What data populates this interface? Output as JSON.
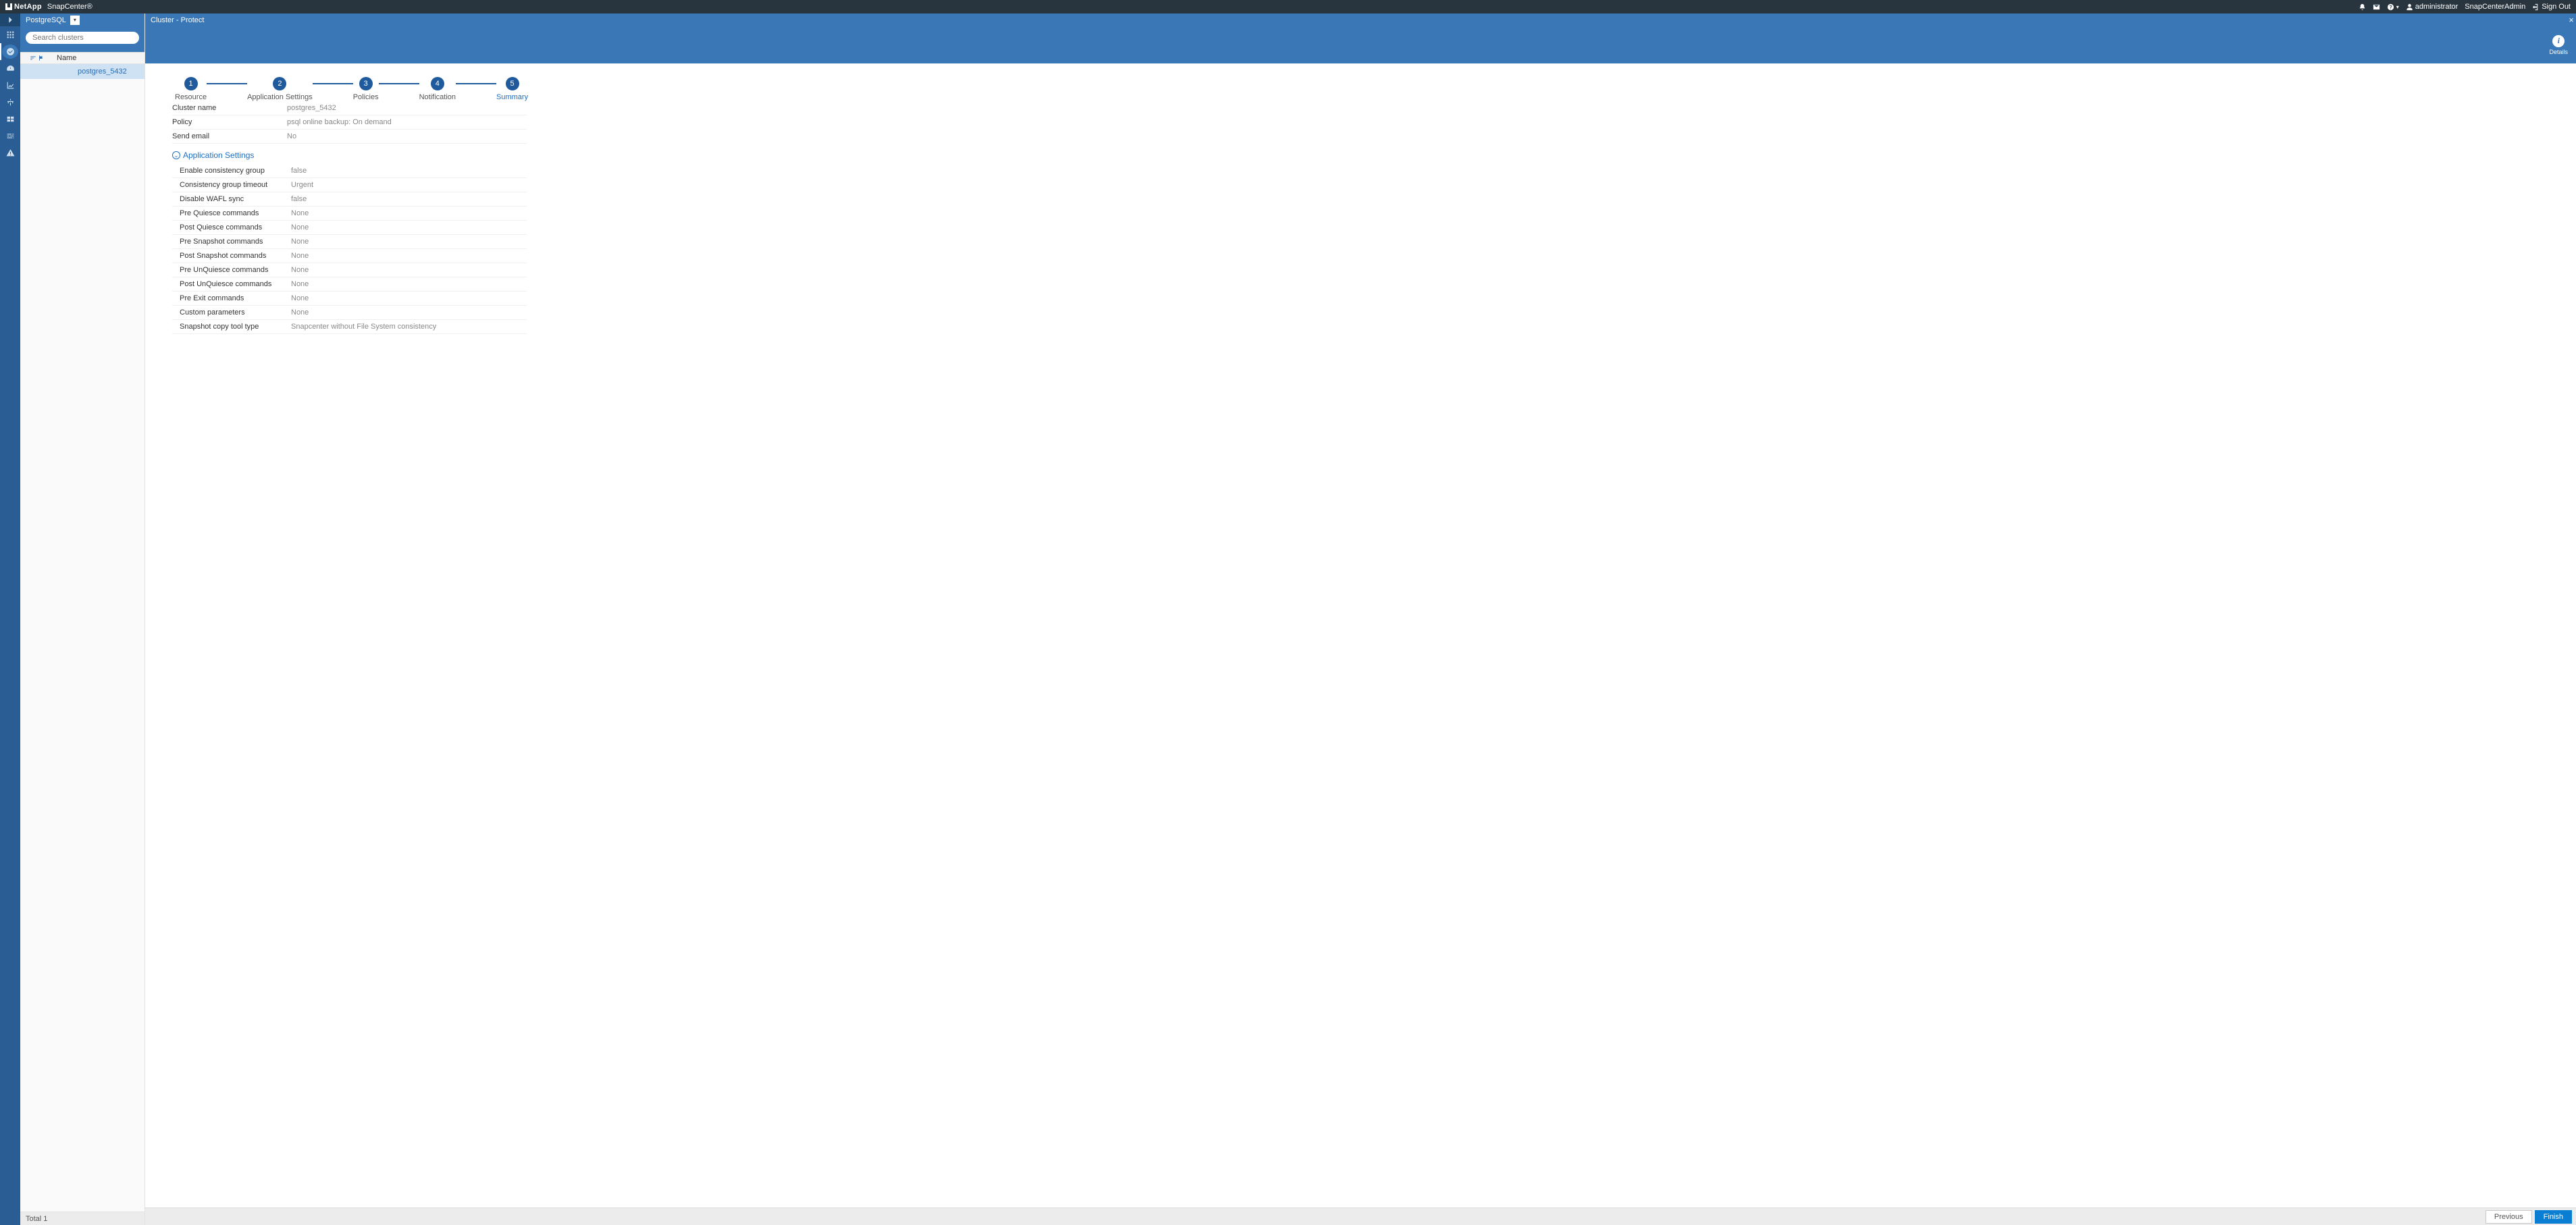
{
  "brand": {
    "company": "NetApp",
    "product": "SnapCenter®"
  },
  "topnav": {
    "user_label": "administrator",
    "role_label": "SnapCenterAdmin",
    "signout_label": "Sign Out"
  },
  "resource_panel": {
    "type_label": "PostgreSQL",
    "search_placeholder": "Search clusters",
    "name_header": "Name",
    "rows": [
      {
        "name": "postgres_5432"
      }
    ],
    "footer_total": "Total 1"
  },
  "breadcrumb": "Cluster - Protect",
  "toolbar": {
    "details_label": "Details"
  },
  "wizard_steps": [
    {
      "num": "1",
      "label": "Resource"
    },
    {
      "num": "2",
      "label": "Application Settings"
    },
    {
      "num": "3",
      "label": "Policies"
    },
    {
      "num": "4",
      "label": "Notification"
    },
    {
      "num": "5",
      "label": "Summary"
    }
  ],
  "summary": {
    "top": [
      {
        "k": "Cluster name",
        "v": "postgres_5432"
      },
      {
        "k": "Policy",
        "v": "psql online backup: On demand"
      },
      {
        "k": "Send email",
        "v": "No"
      }
    ],
    "section_header": "Application Settings",
    "app": [
      {
        "k": "Enable consistency group",
        "v": "false"
      },
      {
        "k": "Consistency group timeout",
        "v": "Urgent"
      },
      {
        "k": "Disable WAFL sync",
        "v": "false"
      },
      {
        "k": "Pre Quiesce commands",
        "v": "None"
      },
      {
        "k": "Post Quiesce commands",
        "v": "None"
      },
      {
        "k": "Pre Snapshot commands",
        "v": "None"
      },
      {
        "k": "Post Snapshot commands",
        "v": "None"
      },
      {
        "k": "Pre UnQuiesce commands",
        "v": "None"
      },
      {
        "k": "Post UnQuiesce commands",
        "v": "None"
      },
      {
        "k": "Pre Exit commands",
        "v": "None"
      },
      {
        "k": "Custom parameters",
        "v": "None"
      },
      {
        "k": "Snapshot copy tool type",
        "v": "Snapcenter without File System consistency"
      }
    ]
  },
  "buttons": {
    "prev": "Previous",
    "finish": "Finish"
  }
}
